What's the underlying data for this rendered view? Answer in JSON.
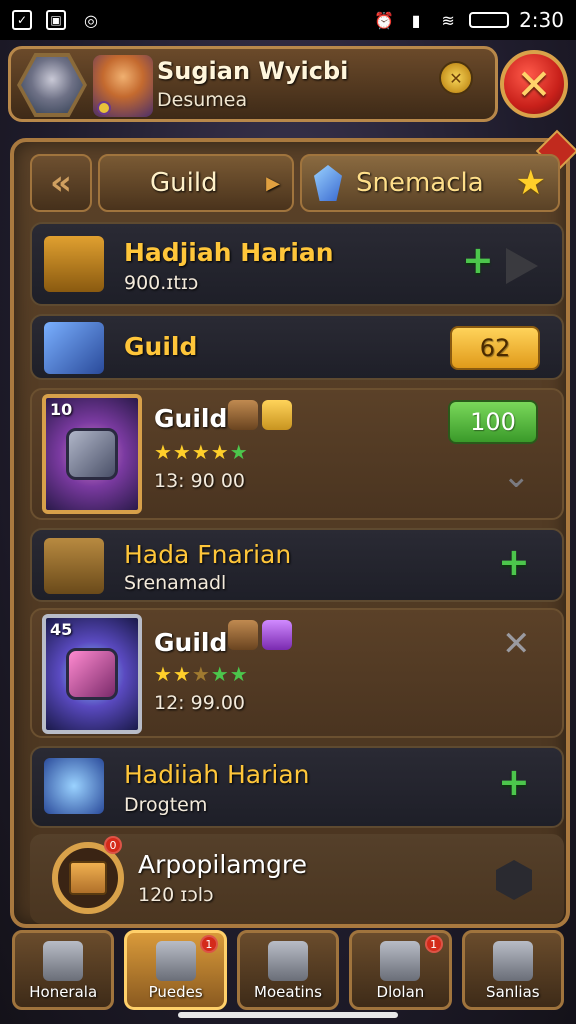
{
  "status_bar": {
    "time": "2:30"
  },
  "header": {
    "player_name": "Sugian Wyicbi",
    "player_subtitle": "Desumea"
  },
  "tabs": {
    "guild_label": "Guild",
    "active_label": "Snemacla"
  },
  "rows": [
    {
      "title": "Hadjiah Harian",
      "subtitle": "900.ɪtɪɔ"
    },
    {
      "title": "Guild",
      "pill": "62"
    },
    {
      "title": "Guild",
      "stars": "★★★★★",
      "subtitle": "13: 90 00",
      "pill": "100",
      "card_level": "10"
    },
    {
      "title": "Hada Fnarian",
      "subtitle": "Srenamadl"
    },
    {
      "title": "Guild",
      "stars": "★★★★★",
      "subtitle": "12: 99.00",
      "card_level": "45"
    },
    {
      "title": "Hadiiah Harian",
      "subtitle": "Drogtem"
    },
    {
      "title": "Arpopilamgre",
      "subtitle": "120 ɪɔlɔ",
      "badge": "0"
    }
  ],
  "bottom_nav": [
    {
      "label": "Honerala"
    },
    {
      "label": "Puedes",
      "active": true,
      "badge": "1"
    },
    {
      "label": "Moeatins"
    },
    {
      "label": "Dlolan",
      "badge": "1"
    },
    {
      "label": "Sanlias"
    }
  ],
  "colors": {
    "gold": "#ffc63a",
    "green": "#4cc64c",
    "frame": "#a9793f",
    "close_red": "#c8201a"
  }
}
